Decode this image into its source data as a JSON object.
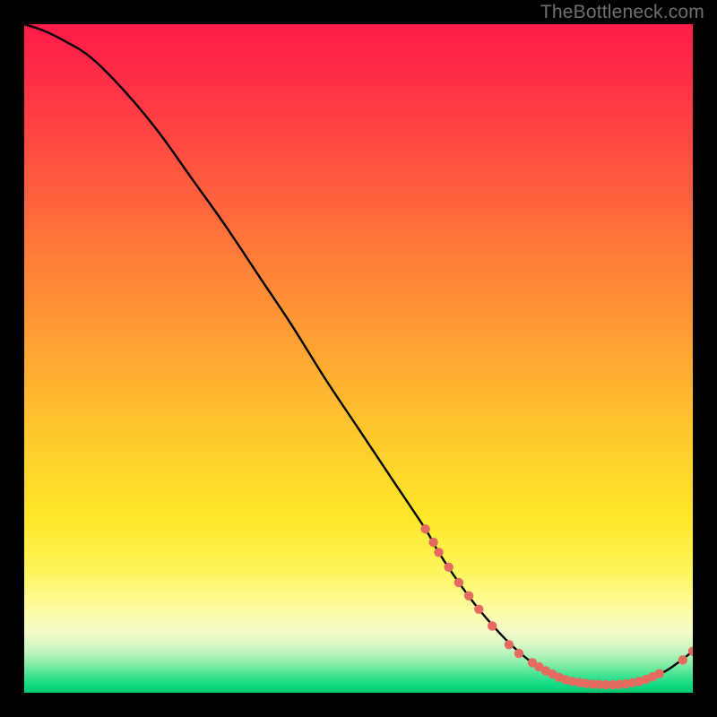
{
  "watermark": "TheBottleneck.com",
  "chart_data": {
    "type": "line",
    "title": "",
    "xlabel": "",
    "ylabel": "",
    "xlim": [
      0,
      100
    ],
    "ylim": [
      0,
      100
    ],
    "grid": false,
    "series": [
      {
        "name": "bottleneck-curve",
        "x": [
          0,
          3,
          6,
          10,
          15,
          20,
          25,
          30,
          35,
          40,
          45,
          50,
          55,
          60,
          62,
          65,
          68,
          72,
          76,
          80,
          84,
          88,
          92,
          96,
          100
        ],
        "y": [
          100,
          99,
          97.5,
          95,
          90,
          84,
          77,
          70,
          62.5,
          55,
          47,
          39.5,
          32,
          24.5,
          21,
          16.5,
          12.5,
          8,
          4.5,
          2.3,
          1.4,
          1.2,
          1.7,
          3.3,
          6.2
        ]
      }
    ],
    "markers": [
      {
        "name": "highlighted-range-points",
        "color": "#e56a60",
        "points": [
          {
            "x": 60.0,
            "y": 24.5
          },
          {
            "x": 61.2,
            "y": 22.5
          },
          {
            "x": 62.0,
            "y": 21.0
          },
          {
            "x": 63.5,
            "y": 18.8
          },
          {
            "x": 65.0,
            "y": 16.5
          },
          {
            "x": 66.5,
            "y": 14.5
          },
          {
            "x": 68.0,
            "y": 12.5
          },
          {
            "x": 70.0,
            "y": 10.0
          },
          {
            "x": 72.5,
            "y": 7.2
          },
          {
            "x": 74.0,
            "y": 5.9
          },
          {
            "x": 76.0,
            "y": 4.5
          },
          {
            "x": 77.0,
            "y": 3.9
          },
          {
            "x": 78.0,
            "y": 3.3
          },
          {
            "x": 79.0,
            "y": 2.8
          },
          {
            "x": 80.0,
            "y": 2.3
          },
          {
            "x": 81.0,
            "y": 1.95
          },
          {
            "x": 82.0,
            "y": 1.7
          },
          {
            "x": 83.0,
            "y": 1.55
          },
          {
            "x": 84.0,
            "y": 1.4
          },
          {
            "x": 85.0,
            "y": 1.3
          },
          {
            "x": 86.0,
            "y": 1.25
          },
          {
            "x": 87.0,
            "y": 1.2
          },
          {
            "x": 88.0,
            "y": 1.2
          },
          {
            "x": 89.0,
            "y": 1.25
          },
          {
            "x": 90.0,
            "y": 1.35
          },
          {
            "x": 91.0,
            "y": 1.5
          },
          {
            "x": 92.0,
            "y": 1.7
          },
          {
            "x": 93.0,
            "y": 2.0
          },
          {
            "x": 94.0,
            "y": 2.4
          },
          {
            "x": 95.0,
            "y": 2.85
          },
          {
            "x": 98.5,
            "y": 4.9
          },
          {
            "x": 100.0,
            "y": 6.2
          }
        ]
      }
    ],
    "gradient_stops": [
      {
        "pos": 0.0,
        "color": "#ff1b4a"
      },
      {
        "pos": 0.5,
        "color": "#ffb030"
      },
      {
        "pos": 0.8,
        "color": "#fdf050"
      },
      {
        "pos": 0.94,
        "color": "#b8f3bb"
      },
      {
        "pos": 1.0,
        "color": "#04c26e"
      }
    ]
  }
}
